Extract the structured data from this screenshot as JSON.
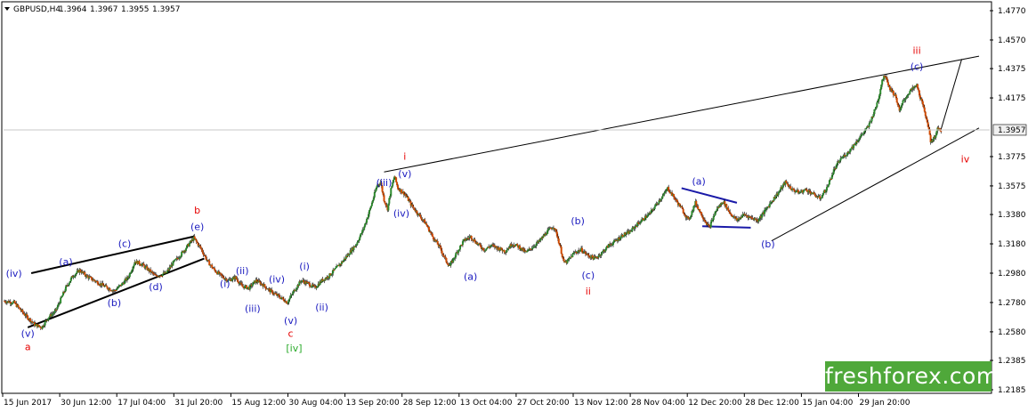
{
  "chart_data": {
    "type": "candlestick",
    "header": {
      "symbol": "GBPUSD,H4",
      "open": "1.3964",
      "high": "1.3967",
      "low": "1.3955",
      "close": "1.3957"
    },
    "current_price": "1.3957",
    "y_ticks": [
      "1.4770",
      "1.4570",
      "1.4375",
      "1.4175",
      "1.3775",
      "1.3575",
      "1.3380",
      "1.3180",
      "1.2980",
      "1.2780",
      "1.2580",
      "1.2385",
      "1.2185"
    ],
    "ylim": [
      1.2185,
      1.477
    ],
    "x_ticks": [
      "15 Jun 2017",
      "30 Jun 12:00",
      "17 Jul 04:00",
      "31 Jul 20:00",
      "15 Aug 12:00",
      "30 Aug 04:00",
      "13 Sep 20:00",
      "28 Sep 12:00",
      "13 Oct 04:00",
      "27 Oct 20:00",
      "13 Nov 12:00",
      "28 Nov 04:00",
      "12 Dec 20:00",
      "28 Dec 12:00",
      "15 Jan 04:00",
      "29 Jan 20:00"
    ],
    "price_path": [
      [
        0,
        1.279
      ],
      [
        3,
        1.278
      ],
      [
        6,
        1.27
      ],
      [
        9,
        1.263
      ],
      [
        11,
        1.261
      ],
      [
        13,
        1.268
      ],
      [
        15,
        1.272
      ],
      [
        18,
        1.288
      ],
      [
        20,
        1.296
      ],
      [
        22,
        1.3
      ],
      [
        24,
        1.296
      ],
      [
        27,
        1.292
      ],
      [
        30,
        1.288
      ],
      [
        32,
        1.286
      ],
      [
        34,
        1.29
      ],
      [
        36,
        1.295
      ],
      [
        38,
        1.306
      ],
      [
        40,
        1.304
      ],
      [
        42,
        1.3
      ],
      [
        44,
        1.296
      ],
      [
        47,
        1.298
      ],
      [
        49,
        1.305
      ],
      [
        51,
        1.31
      ],
      [
        53,
        1.316
      ],
      [
        55,
        1.322
      ],
      [
        57,
        1.315
      ],
      [
        59,
        1.306
      ],
      [
        61,
        1.3
      ],
      [
        63,
        1.296
      ],
      [
        65,
        1.293
      ],
      [
        67,
        1.295
      ],
      [
        69,
        1.289
      ],
      [
        71,
        1.288
      ],
      [
        73,
        1.293
      ],
      [
        75,
        1.29
      ],
      [
        77,
        1.286
      ],
      [
        79,
        1.283
      ],
      [
        81,
        1.28
      ],
      [
        82,
        1.278
      ],
      [
        84,
        1.286
      ],
      [
        86,
        1.293
      ],
      [
        88,
        1.291
      ],
      [
        90,
        1.288
      ],
      [
        92,
        1.293
      ],
      [
        94,
        1.296
      ],
      [
        96,
        1.301
      ],
      [
        98,
        1.306
      ],
      [
        100,
        1.312
      ],
      [
        102,
        1.318
      ],
      [
        104,
        1.328
      ],
      [
        106,
        1.342
      ],
      [
        108,
        1.358
      ],
      [
        109,
        1.36
      ],
      [
        110,
        1.348
      ],
      [
        111,
        1.342
      ],
      [
        112,
        1.355
      ],
      [
        113,
        1.364
      ],
      [
        114,
        1.356
      ],
      [
        116,
        1.352
      ],
      [
        118,
        1.344
      ],
      [
        120,
        1.338
      ],
      [
        122,
        1.332
      ],
      [
        124,
        1.323
      ],
      [
        126,
        1.316
      ],
      [
        128,
        1.306
      ],
      [
        129,
        1.303
      ],
      [
        131,
        1.312
      ],
      [
        133,
        1.32
      ],
      [
        135,
        1.323
      ],
      [
        137,
        1.318
      ],
      [
        139,
        1.314
      ],
      [
        141,
        1.317
      ],
      [
        143,
        1.315
      ],
      [
        145,
        1.313
      ],
      [
        147,
        1.318
      ],
      [
        149,
        1.316
      ],
      [
        151,
        1.312
      ],
      [
        153,
        1.316
      ],
      [
        155,
        1.32
      ],
      [
        157,
        1.326
      ],
      [
        159,
        1.33
      ],
      [
        160,
        1.324
      ],
      [
        161,
        1.315
      ],
      [
        162,
        1.305
      ],
      [
        163,
        1.306
      ],
      [
        165,
        1.312
      ],
      [
        167,
        1.314
      ],
      [
        169,
        1.31
      ],
      [
        171,
        1.308
      ],
      [
        173,
        1.312
      ],
      [
        175,
        1.317
      ],
      [
        177,
        1.32
      ],
      [
        179,
        1.324
      ],
      [
        181,
        1.326
      ],
      [
        183,
        1.331
      ],
      [
        185,
        1.335
      ],
      [
        187,
        1.339
      ],
      [
        189,
        1.346
      ],
      [
        191,
        1.352
      ],
      [
        192,
        1.356
      ],
      [
        194,
        1.349
      ],
      [
        196,
        1.342
      ],
      [
        198,
        1.334
      ],
      [
        200,
        1.346
      ],
      [
        202,
        1.337
      ],
      [
        204,
        1.329
      ],
      [
        206,
        1.341
      ],
      [
        208,
        1.347
      ],
      [
        210,
        1.339
      ],
      [
        212,
        1.334
      ],
      [
        214,
        1.338
      ],
      [
        216,
        1.336
      ],
      [
        218,
        1.334
      ],
      [
        220,
        1.34
      ],
      [
        222,
        1.347
      ],
      [
        224,
        1.353
      ],
      [
        226,
        1.36
      ],
      [
        228,
        1.355
      ],
      [
        230,
        1.353
      ],
      [
        232,
        1.355
      ],
      [
        234,
        1.352
      ],
      [
        236,
        1.349
      ],
      [
        238,
        1.356
      ],
      [
        240,
        1.368
      ],
      [
        242,
        1.376
      ],
      [
        244,
        1.38
      ],
      [
        246,
        1.386
      ],
      [
        248,
        1.392
      ],
      [
        250,
        1.398
      ],
      [
        252,
        1.41
      ],
      [
        253,
        1.418
      ],
      [
        254,
        1.43
      ],
      [
        255,
        1.433
      ],
      [
        256,
        1.425
      ],
      [
        258,
        1.418
      ],
      [
        259,
        1.408
      ],
      [
        260,
        1.415
      ],
      [
        262,
        1.422
      ],
      [
        264,
        1.426
      ],
      [
        265,
        1.418
      ],
      [
        266,
        1.41
      ],
      [
        267,
        1.402
      ],
      [
        268,
        1.388
      ],
      [
        269,
        1.39
      ],
      [
        270,
        1.396
      ],
      [
        271,
        1.3957
      ]
    ],
    "trend_lines": [
      [
        [
          8,
          1.298
        ],
        [
          55,
          1.323
        ]
      ],
      [
        [
          7,
          1.261
        ],
        [
          58,
          1.308
        ]
      ],
      [
        [
          110,
          1.367
        ],
        [
          282,
          1.446
        ]
      ],
      [
        [
          222,
          1.32
        ],
        [
          282,
          1.397
        ]
      ],
      [
        [
          196,
          1.356
        ],
        [
          212,
          1.346
        ]
      ],
      [
        [
          202,
          1.33
        ],
        [
          216,
          1.329
        ]
      ],
      [
        [
          271,
          1.396
        ],
        [
          277,
          1.444
        ]
      ]
    ],
    "annotations": [
      {
        "text": "(iv)",
        "x": 3,
        "y": 1.2955,
        "color": "#1a1abf"
      },
      {
        "text": "(v)",
        "x": 7,
        "y": 1.2545,
        "color": "#1a1abf"
      },
      {
        "text": "a",
        "x": 7,
        "y": 1.2455,
        "color": "#e60000"
      },
      {
        "text": "(a)",
        "x": 18,
        "y": 1.3035,
        "color": "#1a1abf"
      },
      {
        "text": "(b)",
        "x": 32,
        "y": 1.2755,
        "color": "#1a1abf"
      },
      {
        "text": "(c)",
        "x": 35,
        "y": 1.316,
        "color": "#1a1abf"
      },
      {
        "text": "(d)",
        "x": 44,
        "y": 1.2865,
        "color": "#1a1abf"
      },
      {
        "text": "(e)",
        "x": 56,
        "y": 1.3275,
        "color": "#1a1abf"
      },
      {
        "text": "b",
        "x": 56,
        "y": 1.3385,
        "color": "#e60000"
      },
      {
        "text": "(i)",
        "x": 64,
        "y": 1.2885,
        "color": "#1a1abf"
      },
      {
        "text": "(ii)",
        "x": 69,
        "y": 1.2975,
        "color": "#1a1abf"
      },
      {
        "text": "(iii)",
        "x": 72,
        "y": 1.2715,
        "color": "#1a1abf"
      },
      {
        "text": "(iv)",
        "x": 79,
        "y": 1.2915,
        "color": "#1a1abf"
      },
      {
        "text": "(v)",
        "x": 83,
        "y": 1.2635,
        "color": "#1a1abf"
      },
      {
        "text": "c",
        "x": 83,
        "y": 1.2545,
        "color": "#e60000"
      },
      {
        "text": "[iv]",
        "x": 84,
        "y": 1.2445,
        "color": "#2aaa2a"
      },
      {
        "text": "(i)",
        "x": 87,
        "y": 1.3005,
        "color": "#1a1abf"
      },
      {
        "text": "(ii)",
        "x": 92,
        "y": 1.2725,
        "color": "#1a1abf"
      },
      {
        "text": "(iii)",
        "x": 110,
        "y": 1.3575,
        "color": "#1a1abf"
      },
      {
        "text": "(v)",
        "x": 116,
        "y": 1.3635,
        "color": "#1a1abf"
      },
      {
        "text": "i",
        "x": 116,
        "y": 1.3755,
        "color": "#e60000"
      },
      {
        "text": "(iv)",
        "x": 115,
        "y": 1.3365,
        "color": "#1a1abf"
      },
      {
        "text": "(a)",
        "x": 135,
        "y": 1.2935,
        "color": "#1a1abf"
      },
      {
        "text": "(b)",
        "x": 166,
        "y": 1.3315,
        "color": "#1a1abf"
      },
      {
        "text": "(c)",
        "x": 169,
        "y": 1.2945,
        "color": "#1a1abf"
      },
      {
        "text": "ii",
        "x": 169,
        "y": 1.2835,
        "color": "#e60000"
      },
      {
        "text": "(a)",
        "x": 201,
        "y": 1.3585,
        "color": "#1a1abf"
      },
      {
        "text": "(b)",
        "x": 221,
        "y": 1.3155,
        "color": "#1a1abf"
      },
      {
        "text": "(c)",
        "x": 264,
        "y": 1.4365,
        "color": "#1a1abf"
      },
      {
        "text": "iii",
        "x": 264,
        "y": 1.4475,
        "color": "#e60000"
      },
      {
        "text": "iv",
        "x": 278,
        "y": 1.3735,
        "color": "#e60000"
      }
    ]
  },
  "brand": {
    "text": "freshforex.com"
  }
}
